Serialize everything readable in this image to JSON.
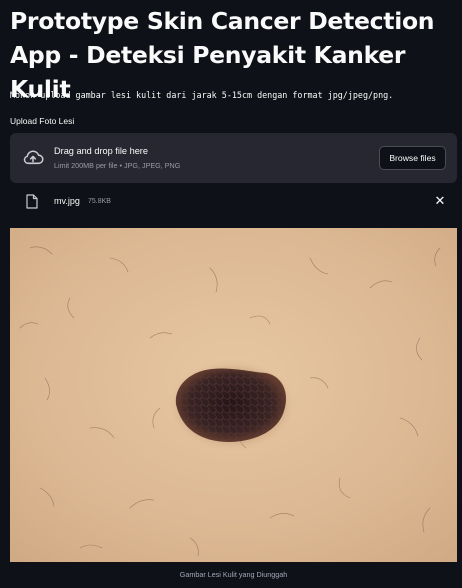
{
  "page": {
    "title": "Prototype Skin Cancer Detection App - Deteksi Penyakit Kanker Kulit",
    "instructions": "Mohon upload gambar lesi kulit dari jarak 5-15cm dengan format jpg/jpeg/png."
  },
  "uploader": {
    "label": "Upload Foto Lesi",
    "drop_text": "Drag and drop file here",
    "limit_text": "Limit 200MB per file • JPG, JPEG, PNG",
    "browse_label": "Browse files",
    "upload_icon": "cloud-upload-icon"
  },
  "uploaded_file": {
    "name": "mv.jpg",
    "size": "75.8KB",
    "file_icon": "file-icon",
    "remove_icon": "close-icon",
    "remove_symbol": "✕"
  },
  "image": {
    "caption": "Gambar Lesi Kulit yang Diunggah"
  },
  "colors": {
    "background": "#0e1117",
    "panel": "#262730",
    "text": "#fafafa",
    "muted": "#9a9ca5",
    "skin": "#dcb893",
    "lesion": "#2a1a1c"
  }
}
